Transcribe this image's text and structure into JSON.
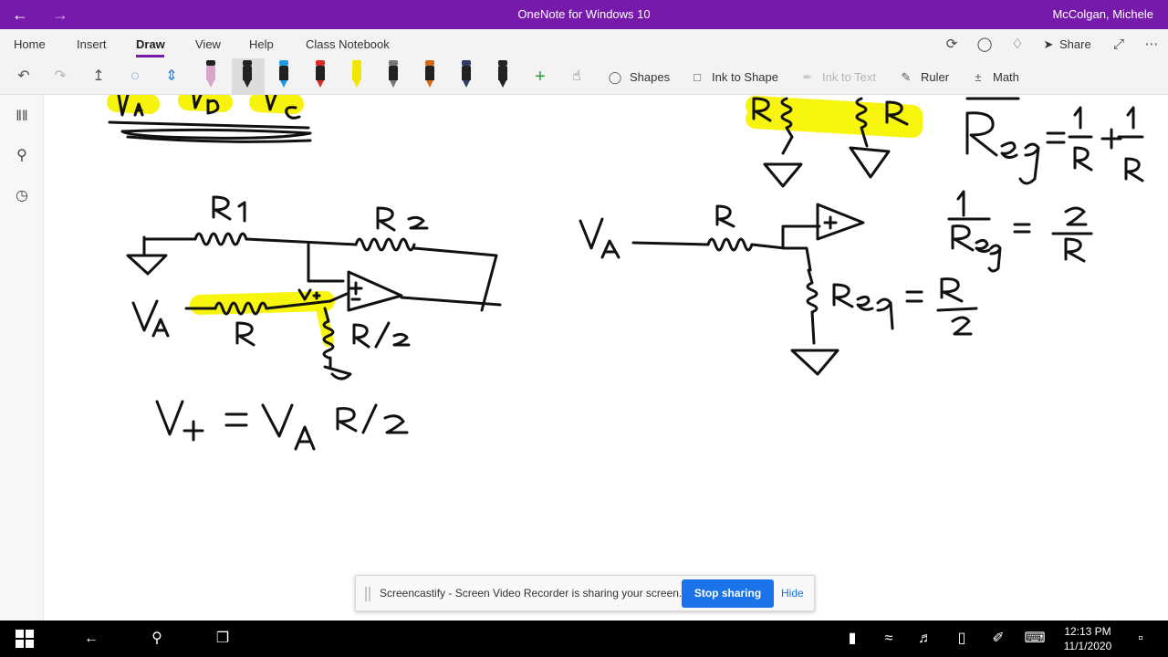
{
  "titlebar": {
    "app_title": "OneNote for Windows 10",
    "user_name": "McColgan, Michele",
    "back_icon": "arrow-left",
    "forward_icon": "arrow-right"
  },
  "menu": {
    "tabs": [
      {
        "label": "Home"
      },
      {
        "label": "Insert"
      },
      {
        "label": "Draw"
      },
      {
        "label": "View"
      },
      {
        "label": "Help"
      },
      {
        "label": "Class Notebook"
      }
    ],
    "active_tab": "Draw",
    "share_label": "Share"
  },
  "toolbar": {
    "pen_colors": [
      "#d9a6c9",
      "#222222",
      "#1e9be0",
      "#d9292a",
      "#f2e600",
      "#777777",
      "#d06a1c",
      "#2e3c66",
      "#222222"
    ],
    "shapes_label": "Shapes",
    "ink_to_shape_label": "Ink to Shape",
    "ink_to_text_label": "Ink to Text",
    "ruler_label": "Ruler",
    "math_label": "Math"
  },
  "share_bar": {
    "message": "Screencastify - Screen Video Recorder is sharing your screen.",
    "stop_label": "Stop sharing",
    "hide_label": "Hide"
  },
  "taskbar": {
    "time": "12:13 PM",
    "date": "11/1/2020"
  },
  "colors": {
    "accent": "#7719aa",
    "highlight": "#f7f300",
    "ink": "#111111",
    "stop_button": "#1a73e8"
  }
}
